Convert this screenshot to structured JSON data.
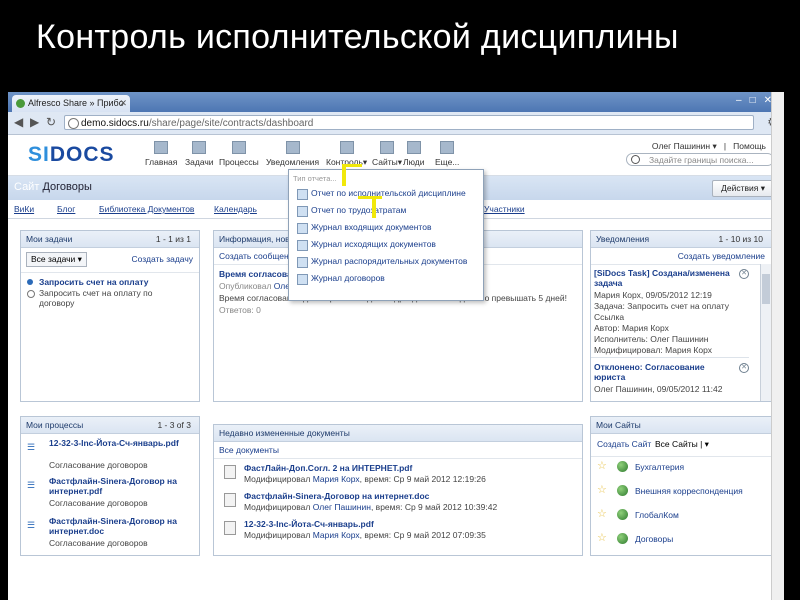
{
  "slide": {
    "title": "Контроль исполнительской дисциплины"
  },
  "browser": {
    "tab_title": "Alfresco Share » Прибо",
    "url_host": "demo.sidocs.ru",
    "url_path": "/share/page/site/contracts/dashboard"
  },
  "app": {
    "logo_a": "SI",
    "logo_b": "DOCS",
    "nav": [
      "Главная",
      "Задачи",
      "Процессы",
      "Уведомления",
      "Контроль",
      "Сайты",
      "Люди",
      "Еще..."
    ],
    "user": "Олег Пашинин",
    "help": "Помощь",
    "search_placeholder": "Задайте границы поиска..."
  },
  "site": {
    "label": "Сайт",
    "name": "Договоры",
    "actions": "Действия",
    "nav": [
      "ВиКи",
      "Блог",
      "Библиотека Документов",
      "Календарь",
      "Участники"
    ]
  },
  "my_tasks": {
    "title": "Мои задачи",
    "count": "1 - 1 из 1",
    "filter": "Все задачи",
    "create": "Создать задачу",
    "item_title": "Запросить счет на оплату",
    "item_desc_1": "Запросить счет на оплату по",
    "item_desc_2": "договору"
  },
  "info": {
    "title": "Информация, нов",
    "create": "Создать сообщен",
    "item_title": "Время согласова",
    "published": "Опубликовал",
    "author": "Олег",
    "text": "Время согласования договоров в каждом подразделении не должно превышать 5 дней!",
    "replies": "Ответов: 0"
  },
  "report_menu": {
    "title": "Тип отчета...",
    "items": [
      "Отчет по исполнительской дисциплине",
      "Отчет по трудозатратам",
      "Журнал входящих документов",
      "Журнал исходящих документов",
      "Журнал распорядительных документов",
      "Журнал договоров"
    ]
  },
  "notifications": {
    "title": "Уведомления",
    "count": "1 - 10 из 10",
    "create": "Создать уведомление",
    "n1": {
      "title": "[SiDocs Task] Создана/изменена задача",
      "line1": "Мария Корх, 09/05/2012 12:19",
      "line2": "Задача: Запросить счет на оплату",
      "line3": "Ссылка",
      "line4": "Автор: Мария Корх",
      "line5": "Исполнитель: Олег Пашинин",
      "line6": "Модифицировал: Мария Корх"
    },
    "n2": {
      "title": "Отклонено: Согласование юриста",
      "line1": "Олег Пашинин, 09/05/2012 11:42"
    }
  },
  "my_processes": {
    "title": "Мои процессы",
    "count": "1 - 3 of 3",
    "items": [
      {
        "name": "12-32-3-Inc-Йота-Сч-январь.pdf",
        "sub": "Согласование договоров"
      },
      {
        "name": "Фастфлайн-Sinera-Договор на интернет.pdf",
        "sub": "Согласование договоров"
      },
      {
        "name": "Фастфлайн-Sinera-Договор на интернет.doc",
        "sub": "Согласование договоров"
      }
    ]
  },
  "recent_docs": {
    "title": "Недавно измененные документы",
    "filter": "Все документы",
    "items": [
      {
        "name": "ФастЛайн-Доп.Согл. 2 на ИНТЕРНЕТ.pdf",
        "mod": "Модифицировал",
        "who": "Мария Корх",
        "when": ", время: Ср 9 май 2012 12:19:26"
      },
      {
        "name": "Фастфлайн-Sinera-Договор на интернет.doc",
        "mod": "Модифицировал",
        "who": "Олег Пашинин",
        "when": ", время: Ср 9 май 2012 10:39:42"
      },
      {
        "name": "12-32-3-Inc-Йота-Сч-январь.pdf",
        "mod": "Модифицировал",
        "who": "Мария Корх",
        "when": ", время: Ср 9 май 2012 07:09:35"
      }
    ]
  },
  "my_sites": {
    "title": "Мои Сайты",
    "create": "Создать Сайт",
    "filter": "Все Сайты",
    "items": [
      "Бухгалтерия",
      "Внешняя корреспонденция",
      "ГлобалКом",
      "Договоры"
    ]
  }
}
